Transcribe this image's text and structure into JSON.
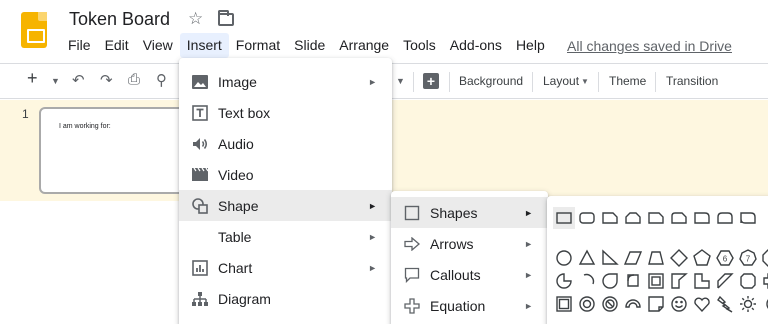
{
  "header": {
    "title": "Token Board",
    "star_icon": "star-outline-icon",
    "folder_icon": "move-to-folder-icon",
    "saved_status": "All changes saved in Drive"
  },
  "menubar": {
    "items": [
      "File",
      "Edit",
      "View",
      "Insert",
      "Format",
      "Slide",
      "Arrange",
      "Tools",
      "Add-ons",
      "Help"
    ],
    "active": "Insert"
  },
  "toolbar": {
    "background": "Background",
    "layout": "Layout",
    "theme": "Theme",
    "transition": "Transition"
  },
  "filmstrip": {
    "slide_number": "1",
    "slide_text": "I am working for:"
  },
  "insert_menu": {
    "items": [
      {
        "label": "Image",
        "icon": "image-icon",
        "submenu": true
      },
      {
        "label": "Text box",
        "icon": "text-box-icon",
        "submenu": false
      },
      {
        "label": "Audio",
        "icon": "audio-icon",
        "submenu": false
      },
      {
        "label": "Video",
        "icon": "video-icon",
        "submenu": false
      },
      {
        "label": "Shape",
        "icon": "shape-icon",
        "submenu": true,
        "highlighted": true
      },
      {
        "label": "Table",
        "icon": "",
        "submenu": true
      },
      {
        "label": "Chart",
        "icon": "chart-icon",
        "submenu": true
      },
      {
        "label": "Diagram",
        "icon": "diagram-icon",
        "submenu": false
      }
    ]
  },
  "shape_menu": {
    "items": [
      {
        "label": "Shapes",
        "icon": "square-icon",
        "highlighted": true
      },
      {
        "label": "Arrows",
        "icon": "arrow-icon"
      },
      {
        "label": "Callouts",
        "icon": "callout-icon"
      },
      {
        "label": "Equation",
        "icon": "equation-icon"
      }
    ]
  },
  "colors": {
    "filmstrip_bg": "#fef7e0",
    "menu_hover": "#ebebeb",
    "app_icon": "#f6b400"
  }
}
